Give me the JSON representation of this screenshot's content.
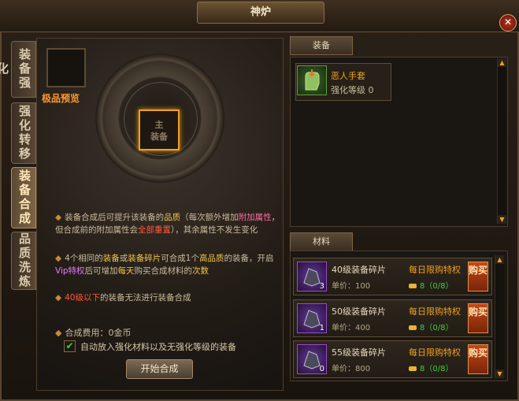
{
  "window": {
    "title": "神炉",
    "close_label": "✕"
  },
  "tabs": [
    {
      "label": "装备强化"
    },
    {
      "label": "强化转移"
    },
    {
      "label": "装备合成"
    },
    {
      "label": "品质洗炼"
    }
  ],
  "preview": {
    "label": "极品预览"
  },
  "main_slot": {
    "line1": "主",
    "line2": "装备"
  },
  "info": {
    "line1": {
      "bullet": "◆",
      "p1": "装备合成后可提升该装备的",
      "h1": "品质",
      "p2": "（每次额外增加",
      "h2": "附加属性",
      "p3": "，但合成前的附加属性会",
      "h3": "全部重置",
      "p4": "），其余属性不发生变化"
    },
    "line2": {
      "bullet": "◆",
      "p1": "4个相同的",
      "h1": "装备",
      "p2": "或",
      "h2": "装备碎片",
      "p3": "可合成1个",
      "h3": "高品质",
      "p4": "的装备，开启",
      "h4": "Vip特权",
      "p5": "后可增加",
      "h5": "每天",
      "p6": "购买合成材料的",
      "h6": "次数"
    },
    "line3": {
      "bullet": "◆",
      "h1": "40级以下",
      "p1": "的装备无法进行装备合成"
    }
  },
  "cost": {
    "bullet": "◆",
    "label": "合成费用：0金币"
  },
  "auto_checkbox": {
    "checked": "✔",
    "label": "自动放入强化材料以及无强化等级的装备"
  },
  "start_button": {
    "label": "开始合成"
  },
  "equipment_section": {
    "tab": "装备",
    "item": {
      "name": "恶人手套",
      "level": "强化等级 0"
    }
  },
  "materials_section": {
    "tab": "材料",
    "items": [
      {
        "name": "40级装备碎片",
        "price": "单价：100",
        "limit_title": "每日限购特权",
        "limit": "8（0/8）",
        "qty": "3",
        "buy": "购买"
      },
      {
        "name": "50级装备碎片",
        "price": "单价：400",
        "limit_title": "每日限购特权",
        "limit": "8（0/8）",
        "qty": "1",
        "buy": "购买"
      },
      {
        "name": "55级装备碎片",
        "price": "单价：800",
        "limit_title": "每日限购特权",
        "limit": "8（0/8）",
        "qty": "0",
        "buy": "购买"
      }
    ]
  },
  "scroll_up": "▲",
  "scroll_down": "▼",
  "colors": {
    "accent": "#f0a020",
    "highlight_yellow": "#f3c34a",
    "highlight_pink": "#ff6aa0",
    "highlight_red": "#ff5a3a",
    "limit_green": "#3ad43a"
  }
}
